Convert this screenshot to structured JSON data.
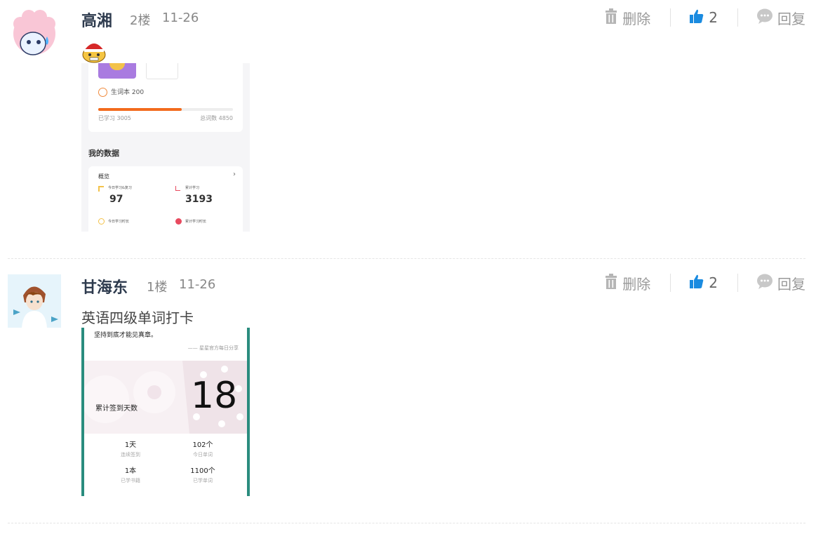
{
  "posts": [
    {
      "author": "高湘",
      "floor": "2楼",
      "date": "11-26",
      "delete_label": "删除",
      "like_count": "2",
      "reply_label": "回复",
      "screenshot": {
        "wordbook_label": "生词本 200",
        "learned_label": "已学习 3005",
        "total_label": "总词数 4850",
        "progress": 0.62,
        "my_data_title": "我的数据",
        "overview_label": "概览",
        "today_label": "今日学习&复习",
        "today_value": "97",
        "cumulative_label": "累计学习",
        "cumulative_value": "3193",
        "today_time_label": "今日学习时长",
        "total_time_label": "累计学习时长"
      }
    },
    {
      "author": "甘海东",
      "floor": "1楼",
      "date": "11-26",
      "delete_label": "删除",
      "like_count": "2",
      "reply_label": "回复",
      "text": "英语四级单词打卡",
      "screenshot": {
        "quote": "坚持到底才能见真章。",
        "source": "—— 星星官方每日分享",
        "checkin_label": "累计签到天数",
        "checkin_value": "18",
        "stats": [
          {
            "value": "1天",
            "label": "连续签到"
          },
          {
            "value": "102个",
            "label": "今日单词"
          },
          {
            "value": "1本",
            "label": "已学书籍"
          },
          {
            "value": "1100个",
            "label": "已学单词"
          }
        ]
      }
    }
  ],
  "colors": {
    "accent": "#1a8be0",
    "name": "#2e3b4e",
    "muted": "#999999",
    "progress": "#f26b1d"
  }
}
